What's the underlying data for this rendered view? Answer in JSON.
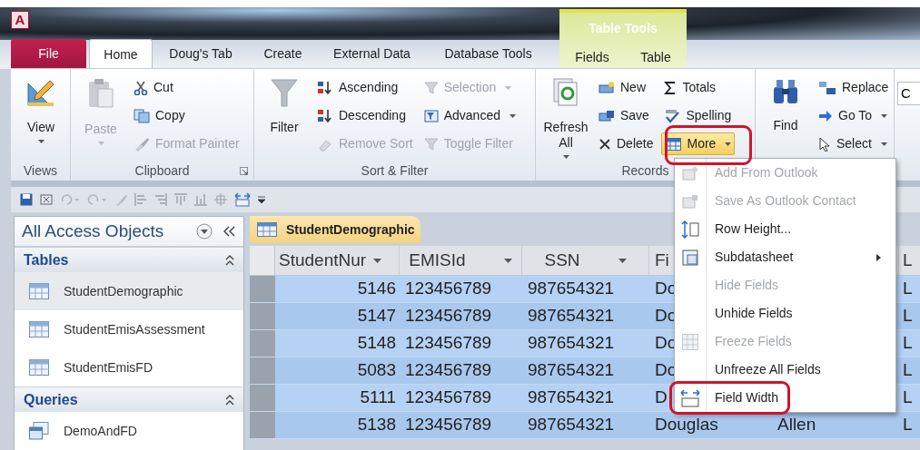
{
  "window": {
    "app_badge": "A"
  },
  "ribbon_tabs": [
    {
      "label": "File",
      "kind": "file",
      "selected": false
    },
    {
      "label": "Home",
      "kind": "tab",
      "selected": true
    },
    {
      "label": "Doug's Tab",
      "kind": "tab",
      "selected": false
    },
    {
      "label": "Create",
      "kind": "tab",
      "selected": false
    },
    {
      "label": "External Data",
      "kind": "tab",
      "selected": false
    },
    {
      "label": "Database Tools",
      "kind": "tab",
      "selected": false
    }
  ],
  "contextual_tabs": {
    "title": "Table Tools",
    "tabs": [
      {
        "label": "Fields",
        "selected": false
      },
      {
        "label": "Table",
        "selected": false
      }
    ]
  },
  "ribbon_groups": [
    {
      "label": "Views",
      "commands": [
        {
          "label": "View",
          "kind": "large",
          "disabled": false,
          "dropdown": true,
          "highlighted": false
        }
      ]
    },
    {
      "label": "Clipboard",
      "launcher": true,
      "commands": [
        {
          "label": "Paste",
          "kind": "large",
          "disabled": true,
          "dropdown": true,
          "highlighted": false
        },
        {
          "label": "Cut",
          "kind": "small",
          "disabled": false,
          "dropdown": false,
          "highlighted": false
        },
        {
          "label": "Copy",
          "kind": "small",
          "disabled": false,
          "dropdown": false,
          "highlighted": false
        },
        {
          "label": "Format Painter",
          "kind": "small",
          "disabled": true,
          "dropdown": false,
          "highlighted": false
        }
      ]
    },
    {
      "label": "Sort & Filter",
      "commands": [
        {
          "label": "Filter",
          "kind": "large",
          "disabled": false,
          "dropdown": false,
          "highlighted": false
        },
        {
          "label": "Ascending",
          "kind": "small",
          "disabled": false,
          "dropdown": false,
          "highlighted": false
        },
        {
          "label": "Descending",
          "kind": "small",
          "disabled": false,
          "dropdown": false,
          "highlighted": false
        },
        {
          "label": "Remove Sort",
          "kind": "small",
          "disabled": true,
          "dropdown": false,
          "highlighted": false
        },
        {
          "label": "Selection",
          "kind": "small",
          "disabled": true,
          "dropdown": true,
          "highlighted": false
        },
        {
          "label": "Advanced",
          "kind": "small",
          "disabled": false,
          "dropdown": true,
          "highlighted": false
        },
        {
          "label": "Toggle Filter",
          "kind": "small",
          "disabled": true,
          "dropdown": false,
          "highlighted": false
        }
      ]
    },
    {
      "label": "Records",
      "commands": [
        {
          "label": "Refresh All",
          "kind": "large",
          "disabled": false,
          "dropdown": true,
          "highlighted": false
        },
        {
          "label": "New",
          "kind": "small",
          "disabled": false,
          "dropdown": false,
          "highlighted": false
        },
        {
          "label": "Save",
          "kind": "small",
          "disabled": false,
          "dropdown": false,
          "highlighted": false
        },
        {
          "label": "Delete",
          "kind": "small",
          "disabled": false,
          "dropdown": false,
          "highlighted": false
        },
        {
          "label": "Totals",
          "kind": "small",
          "disabled": false,
          "dropdown": false,
          "highlighted": false
        },
        {
          "label": "Spelling",
          "kind": "small",
          "disabled": false,
          "dropdown": false,
          "highlighted": false
        },
        {
          "label": "More",
          "kind": "small",
          "disabled": false,
          "dropdown": true,
          "highlighted": true
        }
      ]
    },
    {
      "commands": [
        {
          "label": "Find",
          "kind": "large",
          "disabled": false,
          "dropdown": false,
          "highlighted": false
        },
        {
          "label": "Replace",
          "kind": "small",
          "disabled": false,
          "dropdown": false,
          "highlighted": false
        },
        {
          "label": "Go To",
          "kind": "small",
          "disabled": false,
          "dropdown": true,
          "highlighted": false
        },
        {
          "label": "Select",
          "kind": "small",
          "disabled": false,
          "dropdown": true,
          "highlighted": false
        }
      ]
    }
  ],
  "ribbon_overflow": {
    "font_field": "C"
  },
  "navigation_pane": {
    "title": "All Access Objects",
    "sections": [
      {
        "title": "Tables",
        "expanded": true,
        "items": [
          {
            "label": "StudentDemographic",
            "selected": true
          },
          {
            "label": "StudentEmisAssessment",
            "selected": false
          },
          {
            "label": "StudentEmisFD",
            "selected": false
          }
        ]
      },
      {
        "title": "Queries",
        "expanded": true,
        "items": [
          {
            "label": "DemoAndFD",
            "selected": false
          }
        ]
      }
    ]
  },
  "document_tab": {
    "label": "StudentDemographic",
    "selected": true
  },
  "datasheet": {
    "columns": [
      {
        "label": "StudentNur",
        "filter": true
      },
      {
        "label": "EMISId",
        "filter": true
      },
      {
        "label": "SSN",
        "filter": true
      },
      {
        "label": "Fi",
        "filter": false
      },
      {
        "label": "L",
        "filter": false
      }
    ],
    "rows": [
      {
        "selected": true,
        "student_nur": "5146",
        "emis_id": "123456789",
        "ssn": "987654321",
        "column_4": "Do",
        "column_6": "L"
      },
      {
        "selected": true,
        "student_nur": "5147",
        "emis_id": "123456789",
        "ssn": "987654321",
        "column_4": "Do",
        "column_6": "L"
      },
      {
        "selected": true,
        "student_nur": "5148",
        "emis_id": "123456789",
        "ssn": "987654321",
        "column_4": "Do",
        "column_6": "L"
      },
      {
        "selected": true,
        "student_nur": "5083",
        "emis_id": "123456789",
        "ssn": "987654321",
        "column_4": "Do",
        "column_6": "L"
      },
      {
        "selected": true,
        "student_nur": "5111",
        "emis_id": "123456789",
        "ssn": "987654321",
        "column_4": "D",
        "column_6": "L"
      },
      {
        "selected": true,
        "student_nur": "5138",
        "emis_id": "123456789",
        "ssn": "987654321",
        "column_4": "Douglas",
        "column_5": "Allen",
        "column_6": "L"
      }
    ]
  },
  "more_menu": {
    "items": [
      {
        "label": "Add From Outlook",
        "disabled": true,
        "submenu": false,
        "highlighted": false
      },
      {
        "label": "Save As Outlook Contact",
        "disabled": true,
        "submenu": false,
        "highlighted": false
      },
      {
        "label": "Row Height...",
        "disabled": false,
        "submenu": false,
        "highlighted": false
      },
      {
        "label": "Subdatasheet",
        "disabled": false,
        "submenu": true,
        "highlighted": false
      },
      {
        "label": "Hide Fields",
        "disabled": true,
        "submenu": false,
        "highlighted": false
      },
      {
        "label": "Unhide Fields",
        "disabled": false,
        "submenu": false,
        "highlighted": false
      },
      {
        "label": "Freeze Fields",
        "disabled": true,
        "submenu": false,
        "highlighted": false
      },
      {
        "label": "Unfreeze All Fields",
        "disabled": false,
        "submenu": false,
        "highlighted": false
      },
      {
        "label": "Field Width",
        "disabled": false,
        "submenu": false,
        "highlighted": true
      }
    ]
  }
}
